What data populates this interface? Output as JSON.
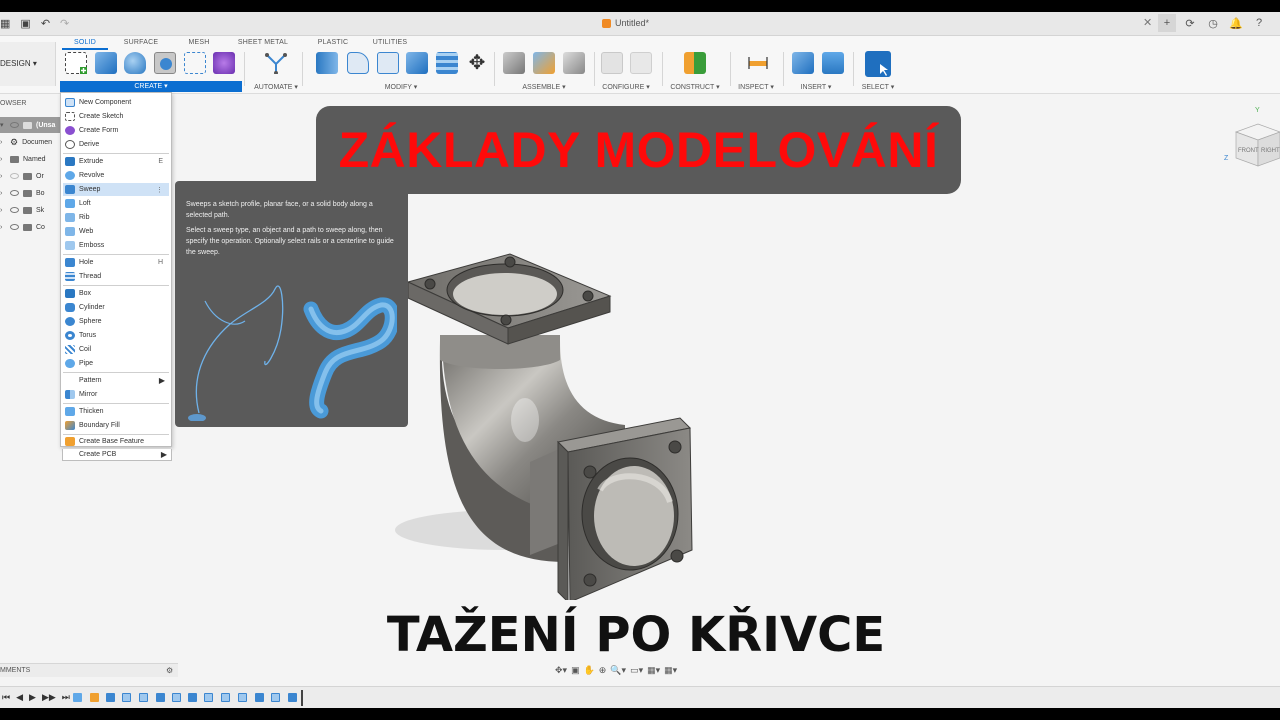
{
  "titlebar": {
    "document_title": "Untitled*",
    "close_glyph": "✕",
    "right_icons": [
      "+",
      "⟳",
      "◷",
      "🔔",
      "?"
    ]
  },
  "toolbar": {
    "workspace": "DESIGN ▾",
    "tabs": [
      "SOLID",
      "SURFACE",
      "MESH",
      "SHEET METAL",
      "PLASTIC",
      "UTILITIES"
    ],
    "active_tab": "SOLID",
    "groups": {
      "create": "CREATE ▾",
      "automate": "AUTOMATE ▾",
      "modify": "MODIFY ▾",
      "assemble": "ASSEMBLE ▾",
      "configure": "CONFIGURE ▾",
      "construct": "CONSTRUCT ▾",
      "inspect": "INSPECT ▾",
      "insert": "INSERT ▾",
      "select": "SELECT ▾"
    },
    "accent_color": "#0b6ed1"
  },
  "browser": {
    "header": "OWSER",
    "rows": [
      "(Unsa",
      "Documen",
      "Named",
      "Or",
      "Bo",
      "Sk",
      "Co"
    ]
  },
  "create_menu": {
    "items": [
      {
        "label": "New Component",
        "shortcut": "",
        "submenu": false
      },
      {
        "label": "Create Sketch",
        "shortcut": "",
        "submenu": false
      },
      {
        "label": "Create Form",
        "shortcut": "",
        "submenu": false
      },
      {
        "label": "Derive",
        "shortcut": "",
        "submenu": false
      },
      {
        "label": "Extrude",
        "shortcut": "E",
        "submenu": false
      },
      {
        "label": "Revolve",
        "shortcut": "",
        "submenu": false
      },
      {
        "label": "Sweep",
        "shortcut": "⋮",
        "submenu": false
      },
      {
        "label": "Loft",
        "shortcut": "",
        "submenu": false
      },
      {
        "label": "Rib",
        "shortcut": "",
        "submenu": false
      },
      {
        "label": "Web",
        "shortcut": "",
        "submenu": false
      },
      {
        "label": "Emboss",
        "shortcut": "",
        "submenu": false
      },
      {
        "label": "Hole",
        "shortcut": "H",
        "submenu": false
      },
      {
        "label": "Thread",
        "shortcut": "",
        "submenu": false
      },
      {
        "label": "Box",
        "shortcut": "",
        "submenu": false
      },
      {
        "label": "Cylinder",
        "shortcut": "",
        "submenu": false
      },
      {
        "label": "Sphere",
        "shortcut": "",
        "submenu": false
      },
      {
        "label": "Torus",
        "shortcut": "",
        "submenu": false
      },
      {
        "label": "Coil",
        "shortcut": "",
        "submenu": false
      },
      {
        "label": "Pipe",
        "shortcut": "",
        "submenu": false
      },
      {
        "label": "Pattern",
        "shortcut": "",
        "submenu": true
      },
      {
        "label": "Mirror",
        "shortcut": "",
        "submenu": false
      },
      {
        "label": "Thicken",
        "shortcut": "",
        "submenu": false
      },
      {
        "label": "Boundary Fill",
        "shortcut": "",
        "submenu": false
      },
      {
        "label": "Create Base Feature",
        "shortcut": "",
        "submenu": false
      },
      {
        "label": "Create PCB",
        "shortcut": "",
        "submenu": true
      }
    ],
    "highlighted": "Sweep"
  },
  "tooltip": {
    "line1": "Sweeps a sketch profile, planar face, or a solid body along a selected path.",
    "line2": "Select a sweep type, an object and a path to sweep along, then specify the operation. Optionally select rails or a centerline to guide the sweep."
  },
  "overlay": {
    "title": "ZÁKLADY MODELOVÁNÍ",
    "subtitle": "TAŽENÍ PO KŘIVCE",
    "title_color": "#ff0a0a",
    "banner_color": "#5a5a5a"
  },
  "comments": {
    "label": "MMENTS"
  },
  "viewcube": {
    "front": "FRONT",
    "right": "RIGHT",
    "axis_y": "Y",
    "axis_z": "Z"
  },
  "timeline": {
    "controls": [
      "⏮",
      "◀",
      "▶",
      "▶▶",
      "⏭"
    ]
  },
  "navbar": {
    "icons": [
      "✥▾",
      "▣",
      "✋",
      "⊕",
      "🔍▾",
      "▭▾",
      "▦▾",
      "▦▾"
    ]
  }
}
